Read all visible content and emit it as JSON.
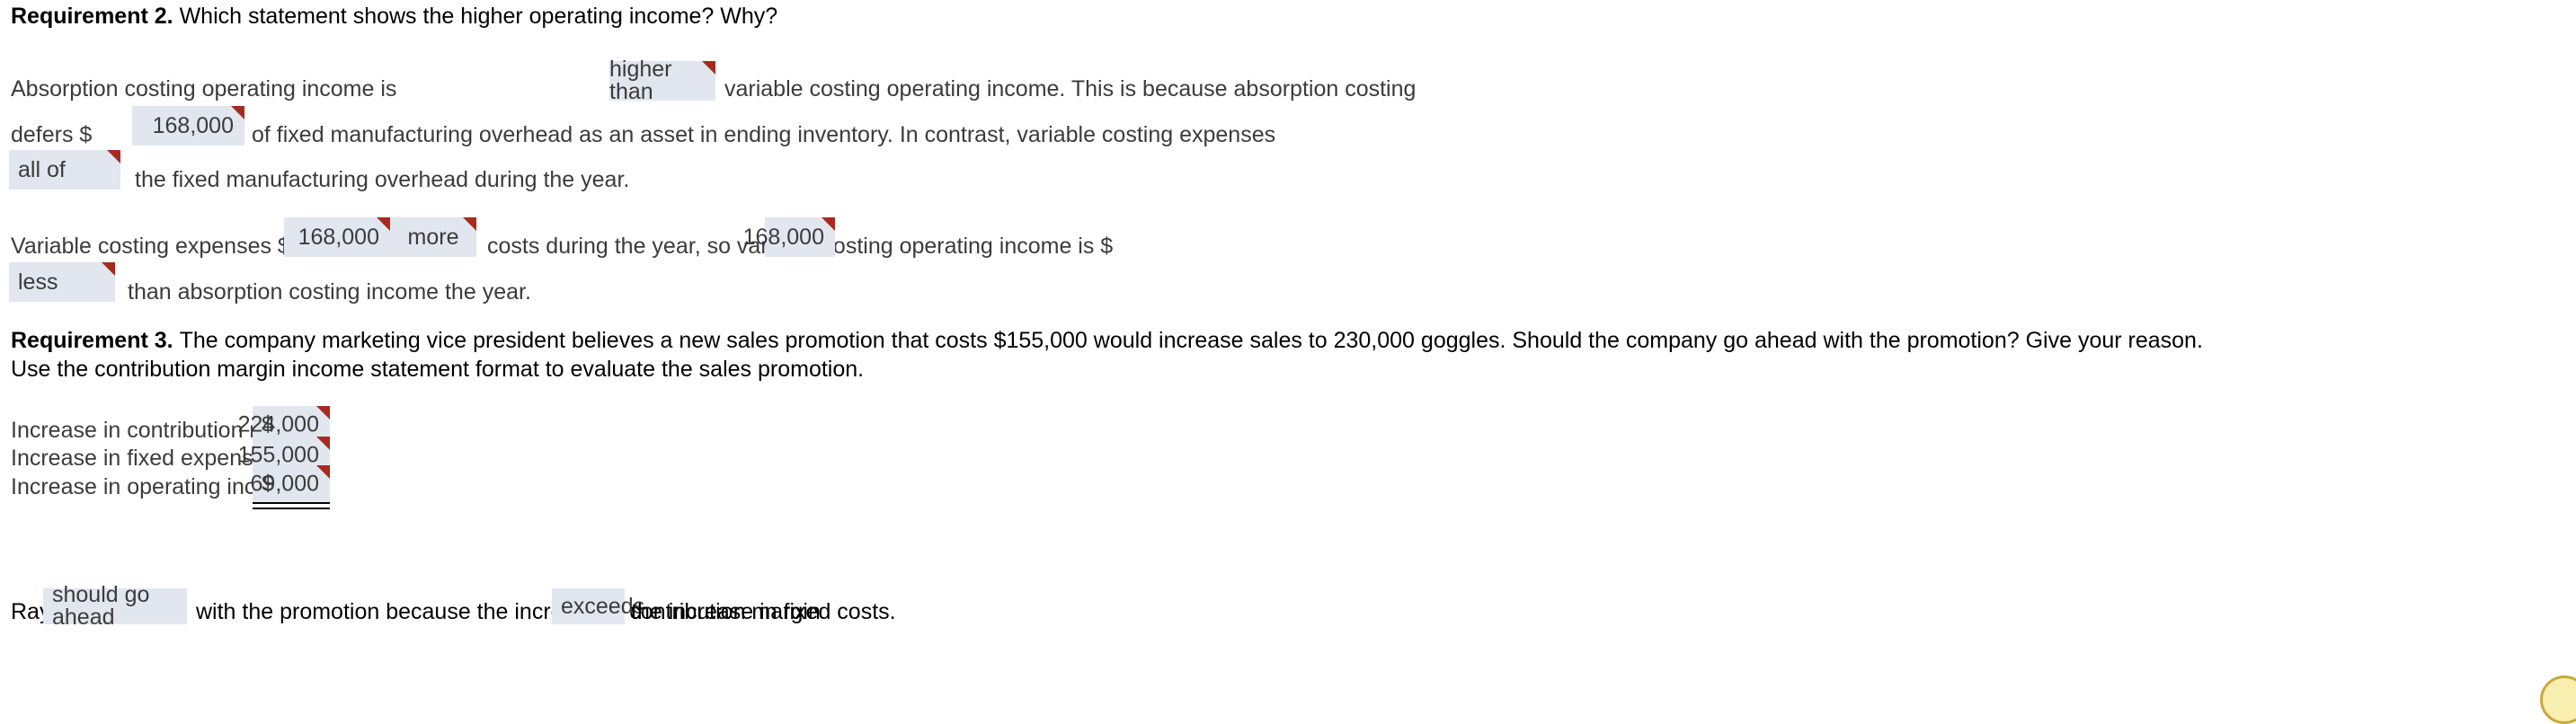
{
  "requirement2": {
    "label": "Requirement 2.",
    "question": "Which statement shows the higher operating income? Why?",
    "para1": {
      "seg1": "Absorption costing operating income is",
      "field_comparison": "higher than",
      "seg2": "variable costing operating income. This is because absorption costing",
      "seg3": "defers $",
      "field_deferred_amount": "168,000",
      "seg4": "of fixed manufacturing overhead as an asset in ending inventory. In contrast, variable costing expenses",
      "field_portion": "all of",
      "seg5": "the fixed manufacturing overhead during the year."
    },
    "para2": {
      "seg1": "Variable costing expenses $",
      "field_amount": "168,000",
      "field_direction": "more",
      "seg2": "costs during the year, so variable costing operating income is $",
      "field_difference": "168,000",
      "field_relation": "less",
      "seg3": "than absorption costing income the year."
    }
  },
  "requirement3": {
    "label": "Requirement 3.",
    "question": "The company marketing vice president believes a new sales promotion that costs $155,000 would increase sales to 230,000 goggles. Should the company go ahead with the promotion? Give your reason.",
    "instruction": "Use the contribution margin income statement format to evaluate the sales promotion.",
    "table": {
      "rows": [
        {
          "label": "Increase in contribution margin",
          "currency": "$",
          "value": "224,000",
          "rule": "none"
        },
        {
          "label": "Increase in fixed expenses",
          "currency": "",
          "value": "155,000",
          "rule": "single"
        },
        {
          "label": "Increase in operating income",
          "currency": "$",
          "value": "69,000",
          "rule": "double"
        }
      ]
    },
    "conclusion": {
      "seg1": "Rays",
      "field_decision": "should go ahead",
      "seg2": "with the promotion because the increase in contribution margin",
      "field_comparison": "exceeds",
      "seg3": "the increase in fixed costs."
    }
  },
  "colors": {
    "field_background": "#e1e6ef",
    "flag_marker": "#a82a1e",
    "body_text": "#3b3b3b",
    "heading_text": "#000000"
  }
}
